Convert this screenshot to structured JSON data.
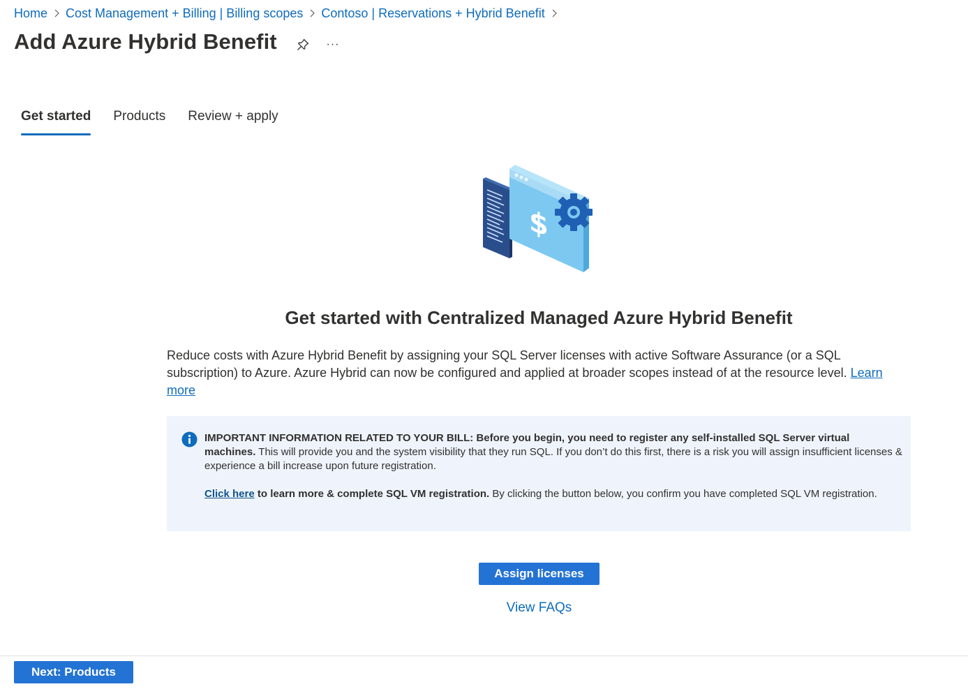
{
  "breadcrumb": {
    "items": [
      {
        "label": "Home"
      },
      {
        "label": "Cost Management + Billing | Billing scopes"
      },
      {
        "label": "Contoso | Reservations + Hybrid Benefit"
      }
    ]
  },
  "header": {
    "title": "Add Azure Hybrid Benefit",
    "more_label": "···",
    "pin_icon": "pin-icon",
    "more_icon": "more-icon"
  },
  "tabs": [
    {
      "label": "Get started",
      "active": true
    },
    {
      "label": "Products",
      "active": false
    },
    {
      "label": "Review + apply",
      "active": false
    }
  ],
  "main": {
    "illustration_icon": "billing-settings-illustration",
    "heading": "Get started with Centralized Managed Azure Hybrid Benefit",
    "description": "Reduce costs with Azure Hybrid Benefit by assigning your SQL Server licenses with active Software Assurance (or a SQL subscription) to Azure. Azure Hybrid can now be configured and applied at broader scopes instead of at the resource level.",
    "learn_more_label": "Learn more",
    "info": {
      "icon": "info-icon",
      "bold_text": "IMPORTANT INFORMATION RELATED TO YOUR BILL: Before you begin, you need to register any self-installed SQL Server virtual machines.",
      "text": "This will provide you and the system visibility that they run SQL. If you don’t do this first, there is a risk you will assign insufficient licenses & experience a bill increase upon future registration.",
      "link_label": "Click here",
      "link_suffix_bold": "to learn more & complete SQL VM registration.",
      "confirm_text": "By clicking the button below, you confirm you have completed SQL VM registration."
    },
    "assign_button": "Assign licenses",
    "faq_link": "View FAQs"
  },
  "footer": {
    "next_button": "Next: Products"
  },
  "colors": {
    "accent": "#0f6cbd",
    "button": "#2373d4",
    "info_bg": "#eff4fc"
  }
}
